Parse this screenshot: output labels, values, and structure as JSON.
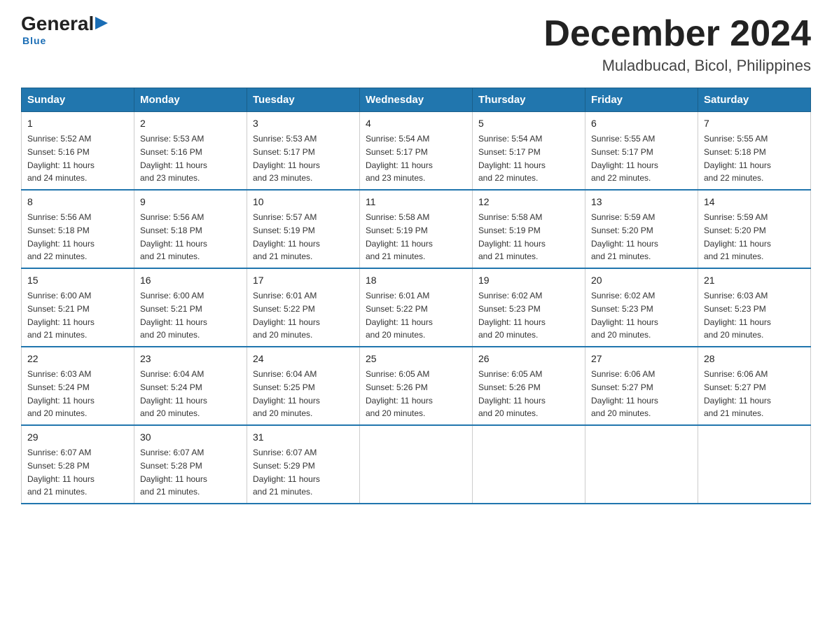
{
  "header": {
    "logo_general": "General",
    "logo_blue": "Blue",
    "month_title": "December 2024",
    "location": "Muladbucad, Bicol, Philippines"
  },
  "days_of_week": [
    "Sunday",
    "Monday",
    "Tuesday",
    "Wednesday",
    "Thursday",
    "Friday",
    "Saturday"
  ],
  "weeks": [
    [
      {
        "day": "1",
        "sunrise": "5:52 AM",
        "sunset": "5:16 PM",
        "daylight": "11 hours and 24 minutes."
      },
      {
        "day": "2",
        "sunrise": "5:53 AM",
        "sunset": "5:16 PM",
        "daylight": "11 hours and 23 minutes."
      },
      {
        "day": "3",
        "sunrise": "5:53 AM",
        "sunset": "5:17 PM",
        "daylight": "11 hours and 23 minutes."
      },
      {
        "day": "4",
        "sunrise": "5:54 AM",
        "sunset": "5:17 PM",
        "daylight": "11 hours and 23 minutes."
      },
      {
        "day": "5",
        "sunrise": "5:54 AM",
        "sunset": "5:17 PM",
        "daylight": "11 hours and 22 minutes."
      },
      {
        "day": "6",
        "sunrise": "5:55 AM",
        "sunset": "5:17 PM",
        "daylight": "11 hours and 22 minutes."
      },
      {
        "day": "7",
        "sunrise": "5:55 AM",
        "sunset": "5:18 PM",
        "daylight": "11 hours and 22 minutes."
      }
    ],
    [
      {
        "day": "8",
        "sunrise": "5:56 AM",
        "sunset": "5:18 PM",
        "daylight": "11 hours and 22 minutes."
      },
      {
        "day": "9",
        "sunrise": "5:56 AM",
        "sunset": "5:18 PM",
        "daylight": "11 hours and 21 minutes."
      },
      {
        "day": "10",
        "sunrise": "5:57 AM",
        "sunset": "5:19 PM",
        "daylight": "11 hours and 21 minutes."
      },
      {
        "day": "11",
        "sunrise": "5:58 AM",
        "sunset": "5:19 PM",
        "daylight": "11 hours and 21 minutes."
      },
      {
        "day": "12",
        "sunrise": "5:58 AM",
        "sunset": "5:19 PM",
        "daylight": "11 hours and 21 minutes."
      },
      {
        "day": "13",
        "sunrise": "5:59 AM",
        "sunset": "5:20 PM",
        "daylight": "11 hours and 21 minutes."
      },
      {
        "day": "14",
        "sunrise": "5:59 AM",
        "sunset": "5:20 PM",
        "daylight": "11 hours and 21 minutes."
      }
    ],
    [
      {
        "day": "15",
        "sunrise": "6:00 AM",
        "sunset": "5:21 PM",
        "daylight": "11 hours and 21 minutes."
      },
      {
        "day": "16",
        "sunrise": "6:00 AM",
        "sunset": "5:21 PM",
        "daylight": "11 hours and 20 minutes."
      },
      {
        "day": "17",
        "sunrise": "6:01 AM",
        "sunset": "5:22 PM",
        "daylight": "11 hours and 20 minutes."
      },
      {
        "day": "18",
        "sunrise": "6:01 AM",
        "sunset": "5:22 PM",
        "daylight": "11 hours and 20 minutes."
      },
      {
        "day": "19",
        "sunrise": "6:02 AM",
        "sunset": "5:23 PM",
        "daylight": "11 hours and 20 minutes."
      },
      {
        "day": "20",
        "sunrise": "6:02 AM",
        "sunset": "5:23 PM",
        "daylight": "11 hours and 20 minutes."
      },
      {
        "day": "21",
        "sunrise": "6:03 AM",
        "sunset": "5:23 PM",
        "daylight": "11 hours and 20 minutes."
      }
    ],
    [
      {
        "day": "22",
        "sunrise": "6:03 AM",
        "sunset": "5:24 PM",
        "daylight": "11 hours and 20 minutes."
      },
      {
        "day": "23",
        "sunrise": "6:04 AM",
        "sunset": "5:24 PM",
        "daylight": "11 hours and 20 minutes."
      },
      {
        "day": "24",
        "sunrise": "6:04 AM",
        "sunset": "5:25 PM",
        "daylight": "11 hours and 20 minutes."
      },
      {
        "day": "25",
        "sunrise": "6:05 AM",
        "sunset": "5:26 PM",
        "daylight": "11 hours and 20 minutes."
      },
      {
        "day": "26",
        "sunrise": "6:05 AM",
        "sunset": "5:26 PM",
        "daylight": "11 hours and 20 minutes."
      },
      {
        "day": "27",
        "sunrise": "6:06 AM",
        "sunset": "5:27 PM",
        "daylight": "11 hours and 20 minutes."
      },
      {
        "day": "28",
        "sunrise": "6:06 AM",
        "sunset": "5:27 PM",
        "daylight": "11 hours and 21 minutes."
      }
    ],
    [
      {
        "day": "29",
        "sunrise": "6:07 AM",
        "sunset": "5:28 PM",
        "daylight": "11 hours and 21 minutes."
      },
      {
        "day": "30",
        "sunrise": "6:07 AM",
        "sunset": "5:28 PM",
        "daylight": "11 hours and 21 minutes."
      },
      {
        "day": "31",
        "sunrise": "6:07 AM",
        "sunset": "5:29 PM",
        "daylight": "11 hours and 21 minutes."
      },
      null,
      null,
      null,
      null
    ]
  ],
  "labels": {
    "sunrise": "Sunrise:",
    "sunset": "Sunset:",
    "daylight": "Daylight:"
  }
}
